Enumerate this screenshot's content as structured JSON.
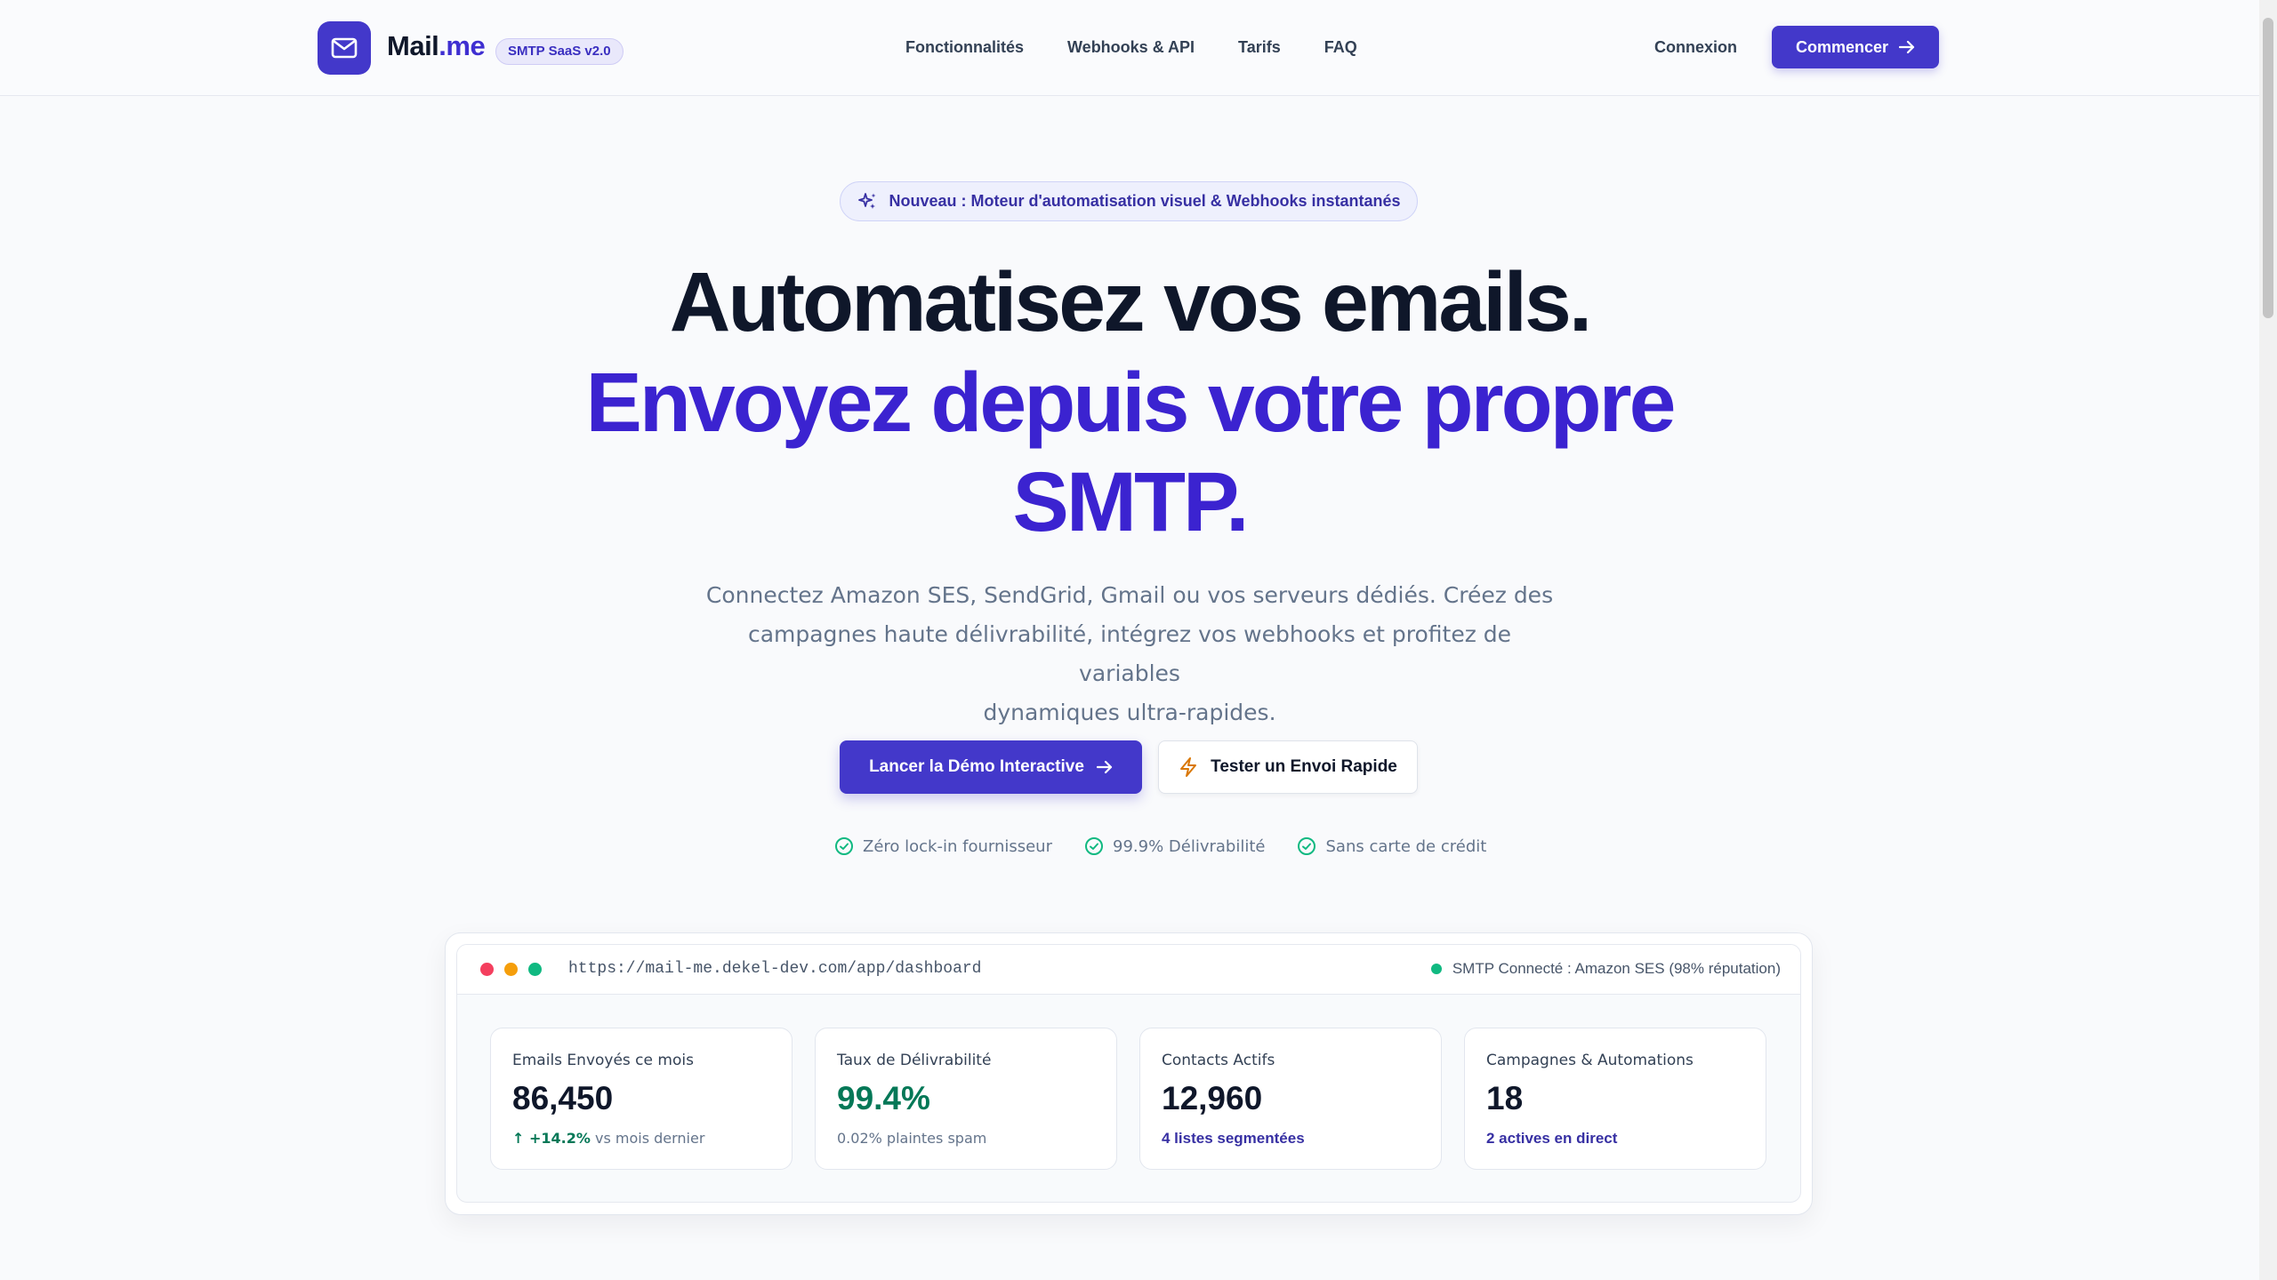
{
  "brand": {
    "name_main": "Mail",
    "name_suffix": ".me",
    "version_badge": "SMTP SaaS v2.0",
    "accent": "#4338ca"
  },
  "nav": {
    "links": [
      "Fonctionnalités",
      "Webhooks & API",
      "Tarifs",
      "FAQ"
    ],
    "login": "Connexion",
    "cta": "Commencer"
  },
  "hero": {
    "announcement": "Nouveau : Moteur d'automatisation visuel & Webhooks instantanés",
    "title_line1": "Automatisez vos emails.",
    "title_line2": "Envoyez depuis votre propre",
    "title_line3": "SMTP.",
    "subtitle_line1": "Connectez Amazon SES, SendGrid, Gmail ou vos serveurs dédiés. Créez des",
    "subtitle_line2": "campagnes haute délivrabilité, intégrez vos webhooks et profitez de variables",
    "subtitle_line3": "dynamiques ultra-rapides.",
    "primary_cta": "Lancer la Démo Interactive",
    "secondary_cta": "Tester un Envoi Rapide",
    "trust": [
      "Zéro lock-in fournisseur",
      "99.9% Délivrabilité",
      "Sans carte de crédit"
    ]
  },
  "preview": {
    "url": "https://mail-me.dekel-dev.com/app/dashboard",
    "smtp_status": "SMTP Connecté : Amazon SES (98% réputation)",
    "window_dots": [
      "#f43f5e",
      "#f59e0b",
      "#10b981"
    ],
    "stats": [
      {
        "label": "Emails Envoyés ce mois",
        "value": "86,450",
        "trend": "↑ +14.2%",
        "note": "vs mois dernier"
      },
      {
        "label": "Taux de Délivrabilité",
        "value": "99.4%",
        "note": "0.02% plaintes spam",
        "value_color": "#047857"
      },
      {
        "label": "Contacts Actifs",
        "value": "12,960",
        "note": "4 listes segmentées"
      },
      {
        "label": "Campagnes & Automations",
        "value": "18",
        "note": "2 actives en direct"
      }
    ]
  }
}
